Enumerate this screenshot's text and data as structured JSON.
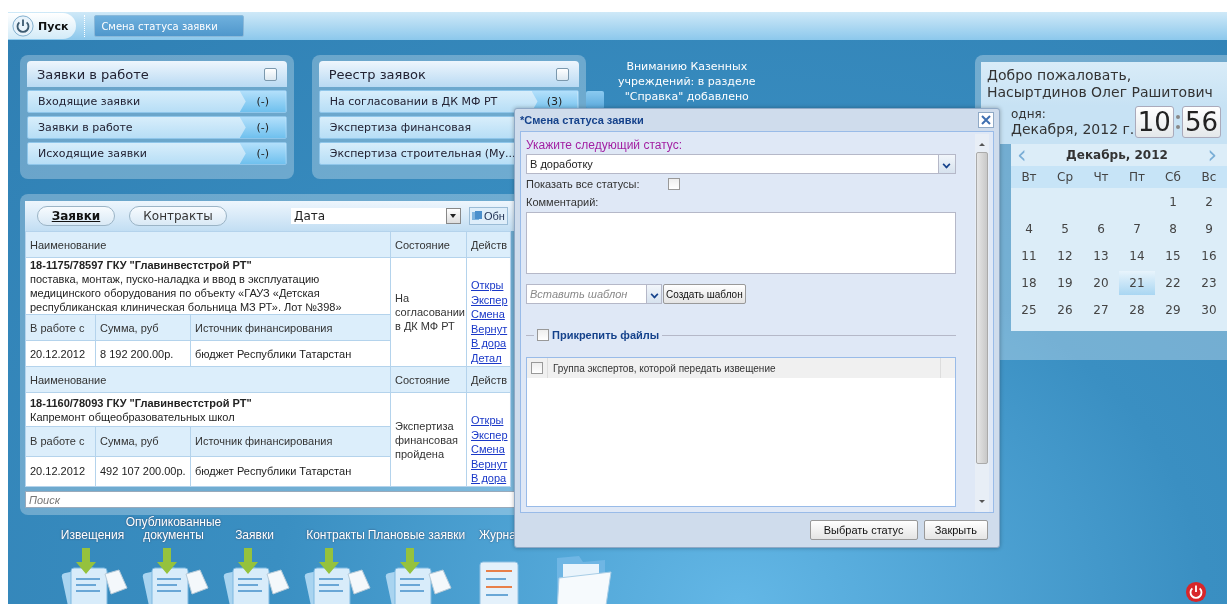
{
  "taskbar": {
    "start_label": "Пуск",
    "tasks": [
      {
        "label": "Смена статуса заявки",
        "selected": true
      }
    ]
  },
  "panels": [
    {
      "title": "Заявки в работе",
      "items": [
        {
          "label": "Входящие заявки",
          "count": "(-)"
        },
        {
          "label": "Заявки в работе",
          "count": "(-)"
        },
        {
          "label": "Исходящие заявки",
          "count": "(-)"
        }
      ]
    },
    {
      "title": "Реестр заявок",
      "items": [
        {
          "label": "На согласовании в ДК МФ РТ",
          "count": "(3)"
        },
        {
          "label": "Экспертиза финансовая"
        },
        {
          "label": "Экспертиза строительная (Му..."
        }
      ]
    }
  ],
  "notice": [
    "Вниманию Казенных",
    "учреждений: в разделе",
    "\"Справка\" добавлено"
  ],
  "grid": {
    "tabs": [
      {
        "label": "Заявки",
        "selected": true
      },
      {
        "label": "Контракты",
        "selected": false
      }
    ],
    "sort": "Дата",
    "refresh_label": "Обн",
    "rows": [
      {
        "columns": [
          "Наименование",
          "Состояние",
          "Действ"
        ],
        "sub_columns": [
          "В работе с",
          "Сумма, руб",
          "Источник финансирования"
        ],
        "title": "18-1175/78597 ГКУ \"Главинвестстрой РТ\"",
        "description": "поставка, монтаж, пуско-наладка и ввод в эксплуатацию медицинского оборудования по объекту «ГАУЗ «Детская республиканская клиническая больница МЗ РТ». Лот №398»",
        "state": "На согласовании в ДК МФ РТ",
        "actions": [
          "Откры",
          "Экспер",
          "Смена",
          "Вернут",
          "В дора",
          "Детал"
        ],
        "since": "20.12.2012",
        "amount": "8 192 200.00р.",
        "source": "бюджет Республики Татарстан"
      },
      {
        "columns": [
          "Наименование",
          "Состояние",
          "Действ"
        ],
        "sub_columns": [
          "В работе с",
          "Сумма, руб",
          "Источник финансирования"
        ],
        "title": "18-1160/78093 ГКУ \"Главинвестстрой РТ\"",
        "description": "Капремонт общеобразовательных школ",
        "state": "Экспертиза финансовая пройдена",
        "actions": [
          "Откры",
          "Экспер",
          "Смена",
          "Вернут",
          "В дора"
        ],
        "since": "20.12.2012",
        "amount": "492 107 200.00р.",
        "source": "бюджет Республики Татарстан"
      }
    ],
    "search_placeholder": "Поиск"
  },
  "dialog": {
    "title": "*Смена статуса заявки",
    "status_label": "Укажите следующий статус:",
    "status_value": "В доработку",
    "show_all_label": "Показать все статусы:",
    "show_all_checked": false,
    "comment_label": "Комментарий:",
    "template_placeholder": "Вставить шаблон",
    "create_template": "Создать шаблон",
    "attach_label": "Прикрепить файлы",
    "attach_checked": false,
    "experts_column": "Группа экспертов, которой передать извещение",
    "experts_all_checked": false,
    "buttons": [
      "Выбрать статус",
      "Закрыть"
    ]
  },
  "welcome": {
    "greeting": [
      "Добро пожаловать,",
      "Насыртдинов Олег Рашитович"
    ],
    "today_label": "одня:",
    "today_date": "Декабря, 2012 г.",
    "clock": [
      "10",
      "56"
    ]
  },
  "calendar": {
    "prev": "‹",
    "next": "›",
    "month": "Декабрь, 2012",
    "weekdays": [
      "Вт",
      "Ср",
      "Чт",
      "Пт",
      "Сб",
      "Вс"
    ],
    "weeks": [
      [
        {
          "day": "1",
          "selected": false
        },
        {
          "day": "2",
          "selected": false
        }
      ],
      [
        {
          "day": "4",
          "selected": false
        },
        {
          "day": "5",
          "selected": false
        },
        {
          "day": "6",
          "selected": false
        },
        {
          "day": "7",
          "selected": false
        },
        {
          "day": "8",
          "selected": false
        },
        {
          "day": "9",
          "selected": false
        }
      ],
      [
        {
          "day": "11",
          "selected": false
        },
        {
          "day": "12",
          "selected": false
        },
        {
          "day": "13",
          "selected": false
        },
        {
          "day": "14",
          "selected": false
        },
        {
          "day": "15",
          "selected": false
        },
        {
          "day": "16",
          "selected": false
        }
      ],
      [
        {
          "day": "18",
          "selected": false
        },
        {
          "day": "19",
          "selected": false
        },
        {
          "day": "20",
          "selected": false
        },
        {
          "day": "21",
          "selected": true
        },
        {
          "day": "22",
          "selected": false
        },
        {
          "day": "23",
          "selected": false
        }
      ],
      [
        {
          "day": "25",
          "selected": false
        },
        {
          "day": "26",
          "selected": false
        },
        {
          "day": "27",
          "selected": false
        },
        {
          "day": "28",
          "selected": false
        },
        {
          "day": "29",
          "selected": false
        },
        {
          "day": "30",
          "selected": false
        }
      ]
    ]
  },
  "dock": [
    {
      "label": "Извещения",
      "kind": "notice"
    },
    {
      "label": "Опубликованные\nдокументы",
      "kind": "notice"
    },
    {
      "label": "Заявки",
      "kind": "notice"
    },
    {
      "label": "Контракты",
      "kind": "notice"
    },
    {
      "label": "Плановые заявки",
      "kind": "notice"
    },
    {
      "label": "Журна",
      "kind": "journal"
    },
    {
      "kind": "folder"
    }
  ]
}
